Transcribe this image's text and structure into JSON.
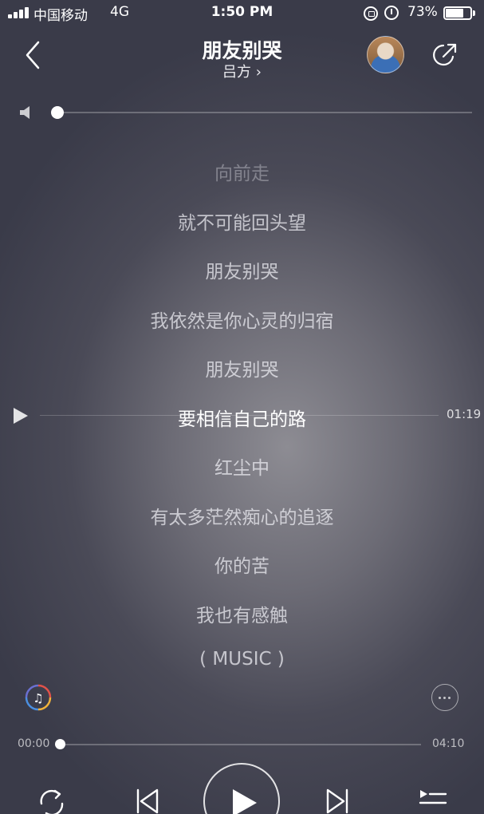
{
  "status_bar": {
    "carrier": "中国移动",
    "network": "4G",
    "time": "1:50 PM",
    "battery_percent": "73%",
    "battery_level": 0.73,
    "icons": [
      "signal-icon",
      "orientation-lock-icon",
      "alarm-icon",
      "battery-icon"
    ]
  },
  "header": {
    "song_title": "朋友别哭",
    "artist": "吕方 ›",
    "icons": [
      "back-icon",
      "artist-avatar",
      "share-icon"
    ]
  },
  "volume": {
    "level": 0.0,
    "icon": "speaker-icon"
  },
  "lyrics": {
    "lines": [
      "向前走",
      "就不可能回头望",
      "朋友别哭",
      "我依然是你心灵的归宿",
      "朋友别哭",
      "要相信自己的路",
      "红尘中",
      "有太多茫然痴心的追逐",
      "你的苦",
      "我也有感触",
      "( MUSIC )"
    ],
    "current_index": 5,
    "seek_time": "01:19"
  },
  "player": {
    "elapsed": "00:00",
    "duration": "04:10",
    "progress": 0.0,
    "controls": [
      "repeat-icon",
      "previous-icon",
      "play-icon",
      "next-icon",
      "playlist-icon"
    ],
    "extra_icons": [
      "sound-quality-icon",
      "more-icon"
    ]
  },
  "colors": {
    "background_center": "#8d8c93",
    "background_edge": "#3a3b49",
    "text": "#ffffff"
  }
}
